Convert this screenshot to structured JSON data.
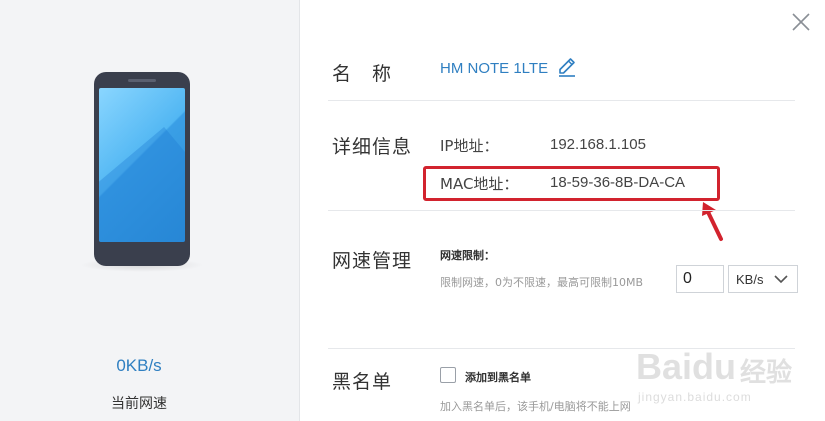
{
  "left_panel": {
    "speed_value": "0KB/s",
    "speed_label": "当前网速"
  },
  "name_section": {
    "label": "名　称",
    "device_name": "HM NOTE 1LTE"
  },
  "detail_section": {
    "label": "详细信息",
    "ip_key": "IP地址：",
    "ip_value": "192.168.1.105",
    "mac_key": "MAC地址：",
    "mac_value": "18-59-36-8B-DA-CA"
  },
  "speed_section": {
    "label": "网速管理",
    "title": "网速限制：",
    "hint": "限制网速，0为不限速，最高可限制10MB",
    "input_value": "0",
    "unit": "KB/s"
  },
  "blacklist_section": {
    "label": "黑名单",
    "checkbox_label": "添加到黑名单",
    "hint": "加入黑名单后，该手机/电脑将不能上网",
    "checked": false
  },
  "watermark": {
    "word": "Baidu",
    "cn": "经验",
    "url": "jingyan.baidu.com"
  },
  "colors": {
    "accent": "#2f7fc1",
    "highlight": "#d2232e",
    "panel_bg": "#f3f4f6"
  },
  "icons": {
    "close": "close-icon",
    "edit": "pencil-edit-icon",
    "dropdown": "chevron-down-icon",
    "arrow": "red-arrow-annotation"
  }
}
